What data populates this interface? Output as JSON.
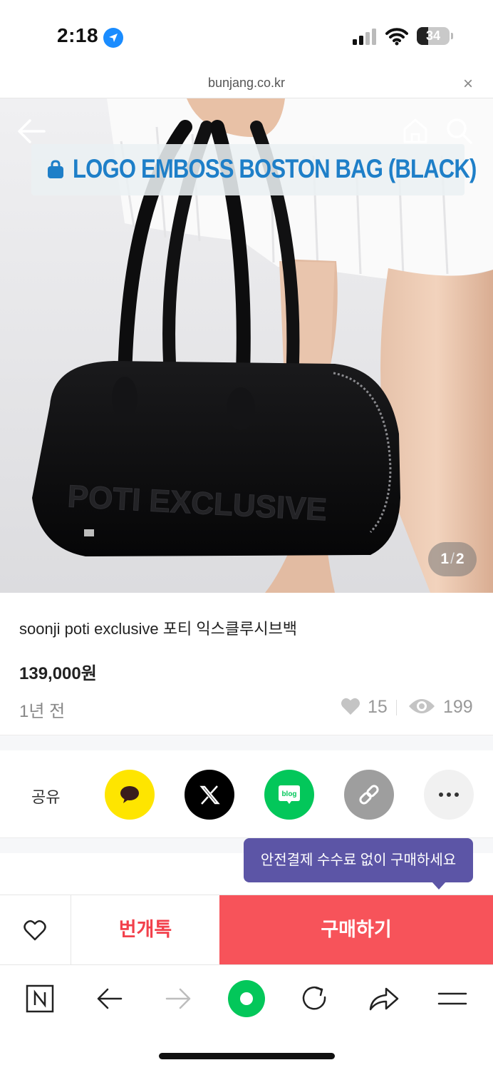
{
  "status_bar": {
    "time": "2:18",
    "battery": "34",
    "battery_level": 0.34
  },
  "browser": {
    "url": "bunjang.co.kr",
    "close_label": "×"
  },
  "hero": {
    "banner_text": "LOGO EMBOSS BOSTON BAG (BLACK)",
    "embossed_text": "POTI EXCLUSIVE",
    "counter_current": "1",
    "counter_separator": "/",
    "counter_total": "2"
  },
  "product": {
    "title": "soonji poti exclusive 포티 익스클루시브백",
    "price": "139,000원",
    "posted": "1년 전",
    "likes": "15",
    "views": "199"
  },
  "share": {
    "label": "공유",
    "blog_icon_text": "blog"
  },
  "tooltip": {
    "text": "안전결제 수수료 없이 구매하세요"
  },
  "actions": {
    "chat_label": "번개톡",
    "buy_label": "구매하기"
  },
  "colors": {
    "accent": "#f7535a",
    "chat_red": "#f2404b",
    "tooltip_purple": "#5c55a6",
    "naver_green": "#03c75a",
    "kakao_yellow": "#fee500"
  },
  "icons": [
    "location-arrow-icon",
    "signal-icon",
    "wifi-icon",
    "battery-icon",
    "close-icon",
    "back-arrow-icon",
    "home-icon",
    "search-icon",
    "shopping-bag-icon",
    "heart-icon",
    "eye-icon",
    "kakao-icon",
    "x-logo-icon",
    "blog-icon",
    "link-icon",
    "more-icon",
    "naver-n-icon",
    "forward-arrow-icon",
    "reload-icon",
    "share-icon",
    "menu-icon"
  ]
}
